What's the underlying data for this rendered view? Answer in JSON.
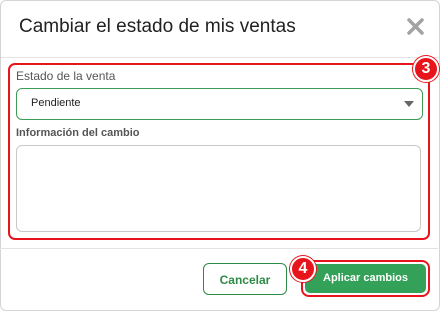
{
  "dialog": {
    "title": "Cambiar el estado de mis ventas",
    "close_icon": "close-x-icon"
  },
  "form": {
    "status_label": "Estado de la venta",
    "status_value": "Pendiente",
    "info_label": "Información del cambio",
    "info_value": ""
  },
  "footer": {
    "cancel_label": "Cancelar",
    "apply_label": "Aplicar cambios"
  },
  "annotations": {
    "form_step": "3",
    "apply_step": "4"
  },
  "colors": {
    "accent_green": "#33a157",
    "highlight_red": "#e8141b"
  }
}
